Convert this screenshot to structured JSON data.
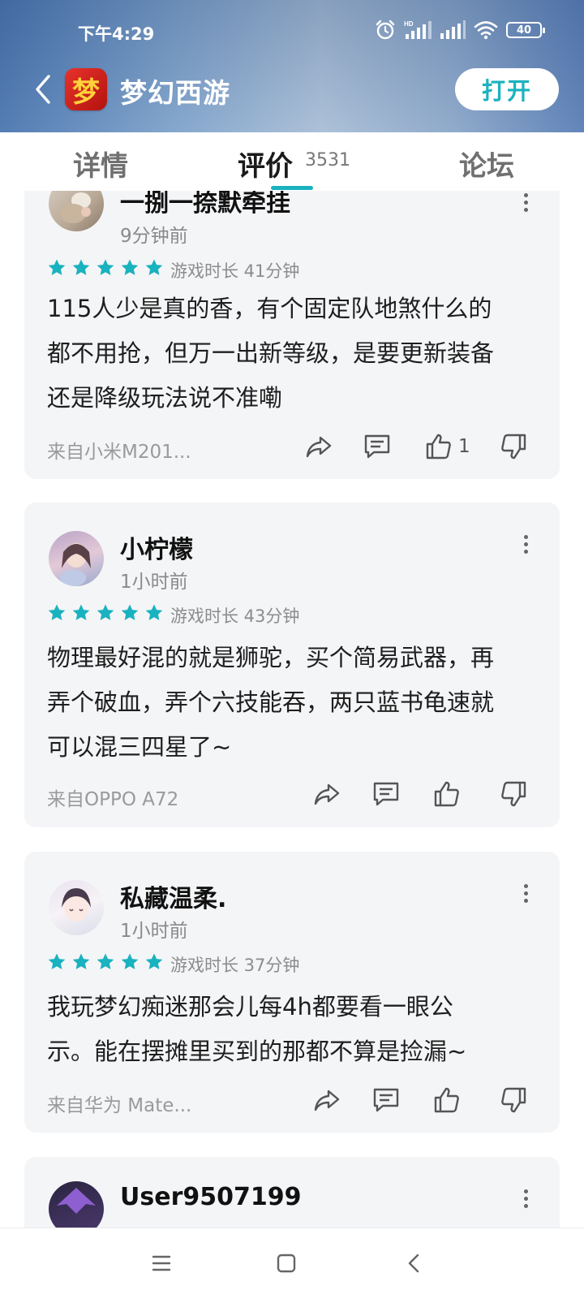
{
  "status_bar": {
    "time": "下午4:29",
    "battery": "40",
    "signal_label": "HD"
  },
  "header": {
    "app_icon_glyph": "梦",
    "app_name": "梦幻西游",
    "open_button": "打开"
  },
  "tabs": {
    "details": "详情",
    "reviews": "评价",
    "reviews_count": "3531",
    "forum": "论坛"
  },
  "colors": {
    "accent": "#19b2bf",
    "card_bg": "#f4f5f7"
  },
  "reviews": [
    {
      "name": "一捌一捺默牵挂",
      "time": "9分钟前",
      "stars": 5,
      "playtime": "游戏时长 41分钟",
      "text_lines": [
        "115人少是真的香，有个固定队地煞什么的",
        "都不用抢，但万一出新等级，是要更新装备",
        "还是降级玩法说不准嘞"
      ],
      "device": "来自小米M201...",
      "likes": "1"
    },
    {
      "name": "小柠檬",
      "time": "1小时前",
      "stars": 5,
      "playtime": "游戏时长 43分钟",
      "text_lines": [
        "物理最好混的就是狮驼，买个简易武器，再",
        "弄个破血，弄个六技能吞，两只蓝书龟速就",
        "可以混三四星了~"
      ],
      "device": "来自OPPO A72",
      "likes": ""
    },
    {
      "name": "私藏温柔.",
      "time": "1小时前",
      "stars": 5,
      "playtime": "游戏时长 37分钟",
      "text_lines": [
        "我玩梦幻痴迷那会儿每4h都要看一眼公",
        "示。能在摆摊里买到的那都不算是捡漏~"
      ],
      "device": "来自华为 Mate...",
      "likes": ""
    },
    {
      "name": "User9507199"
    }
  ]
}
